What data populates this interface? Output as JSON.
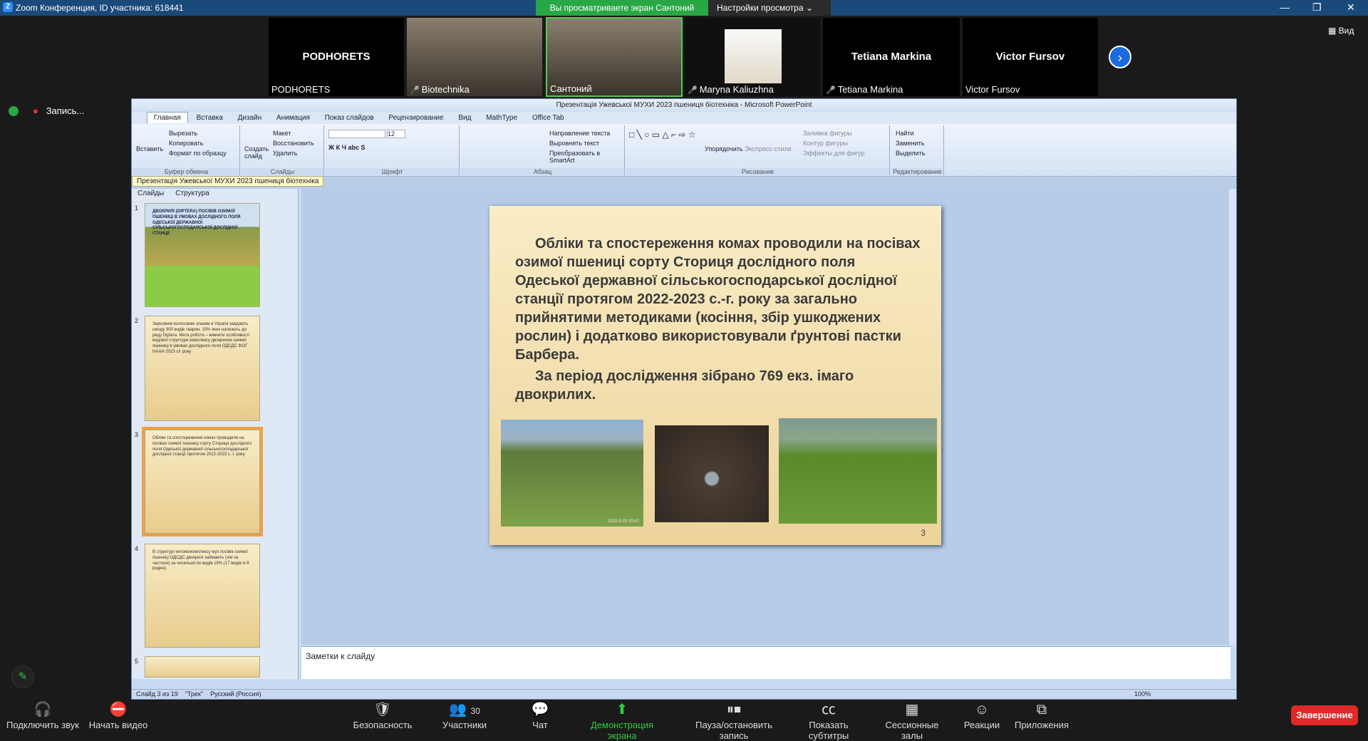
{
  "zoom": {
    "title": "Zoom Конференция, ID участника: 618441",
    "share_notice": "Вы просматриваете экран Сантоний",
    "view_settings": "Настройки просмотра",
    "view_label": "Вид",
    "record_label": "Запись...",
    "gallery": [
      {
        "big": "PODHORETS",
        "label": "PODHORETS",
        "muted": false
      },
      {
        "big": "",
        "label": "Biotechnika",
        "muted": true
      },
      {
        "big": "",
        "label": "Сантоний",
        "muted": false
      },
      {
        "big": "",
        "label": "Maryna Kaliuzhna",
        "muted": true
      },
      {
        "big": "Tetiana Markina",
        "label": "Tetiana Markina",
        "muted": true
      },
      {
        "big": "Victor Fursov",
        "label": "Victor Fursov",
        "muted": false
      }
    ],
    "toolbar": {
      "audio": "Подключить звук",
      "video": "Начать видео",
      "security": "Безопасность",
      "participants": "Участники",
      "participants_count": "30",
      "chat": "Чат",
      "share": "Демонстрация экрана",
      "pause_record": "Пауза/остановить запись",
      "captions": "Показать субтитры",
      "rooms": "Сессионные залы",
      "reactions": "Реакции",
      "apps": "Приложения",
      "end": "Завершение"
    }
  },
  "ppt": {
    "title": "Презентація Ужевської МУХИ 2023 пшениця  біотехніка - Microsoft PowerPoint",
    "menu": [
      "Главная",
      "Вставка",
      "Дизайн",
      "Анимация",
      "Показ слайдов",
      "Рецензирование",
      "Вид",
      "MathType",
      "Office Tab"
    ],
    "ribbon": {
      "clipboard": {
        "paste": "Вставить",
        "cut": "Вырезать",
        "copy": "Копировать",
        "format": "Формат по образцу",
        "label": "Буфер обмена"
      },
      "slides": {
        "new": "Создать слайд",
        "layout": "Макет",
        "reset": "Восстановить",
        "delete": "Удалить",
        "label": "Слайды"
      },
      "font": {
        "size": "12",
        "label": "Шрифт"
      },
      "paragraph": {
        "direction": "Направление текста",
        "align": "Выровнять текст",
        "smartart": "Преобразовать в SmartArt",
        "label": "Абзац"
      },
      "drawing": {
        "arrange": "Упорядочить",
        "styles": "Экспресс-стили",
        "fill": "Заливка фигуры",
        "outline": "Контур фигуры",
        "effects": "Эффекты для фигур",
        "label": "Рисование"
      },
      "editing": {
        "find": "Найти",
        "replace": "Заменить",
        "select": "Выделить",
        "label": "Редактирование"
      }
    },
    "doc_tab": "Презентація Ужевської МУХИ 2023 пшениця  біотехніка",
    "panel_tabs": [
      "Слайды",
      "Структура"
    ],
    "thumbs": [
      {
        "n": "1",
        "text": "ДВОКРИЛІ (DIPTERA) ПОСІВІВ ОЗИМОЇ ПШЕНИЦІ В УМОВАХ ДОСЛІДНОГО ПОЛЯ ОДЕСЬКОЇ ДЕРЖАВНОЇ СІЛЬСЬКОГОСПОДАРСЬКОЇ ДОСЛІДНОЇ СТАНЦІЇ"
      },
      {
        "n": "2",
        "text": "Зерновим колосовим злакам в Україні завдають шкоду 300 видів тварин, 15% яких належать до ряду Diptera. Мета роботи – вивчити особливості видової структури комплексу двокрилих озимої пшениці в умовах дослідного поля ОДСДС ІКОГ НААН 2023 с/г року"
      },
      {
        "n": "3",
        "text": "Обліки та спостереження комах проводили на посівах озимої пшениці сорту Сториця дослідного поля Одеської державної сільськогосподарської дослідної станції протягом 2022-2023 с.-г. року"
      },
      {
        "n": "4",
        "text": "В структурі ентомокомплексу мух посівів озимої пшениці ОДСДС двокрилі займають (з/м за часткою) за чисельністю видів 19% (17 видів із 9 родин)."
      },
      {
        "n": "5",
        "text": ""
      }
    ],
    "slide": {
      "p1": "Обліки та спостереження комах проводили на посівах озимої пшениці сорту Сториця дослідного поля Одеської державної сільськогосподарської дослідної станції протягом 2022-2023 с.-г. року за загально прийнятими методиками (косіння, збір ушкоджених рослин) і додатково використовували ґрунтові пастки Барбера.",
      "p2": "За період дослідження зібрано 769 екз. імаго двокрилих.",
      "number": "3",
      "photo_date": "2022-5-23 10:47"
    },
    "notes": "Заметки к слайду",
    "status": {
      "slide": "Слайд 3 из 19",
      "theme": "\"Трек\"",
      "lang": "Русский (Россия)",
      "zoom": "100%"
    }
  }
}
